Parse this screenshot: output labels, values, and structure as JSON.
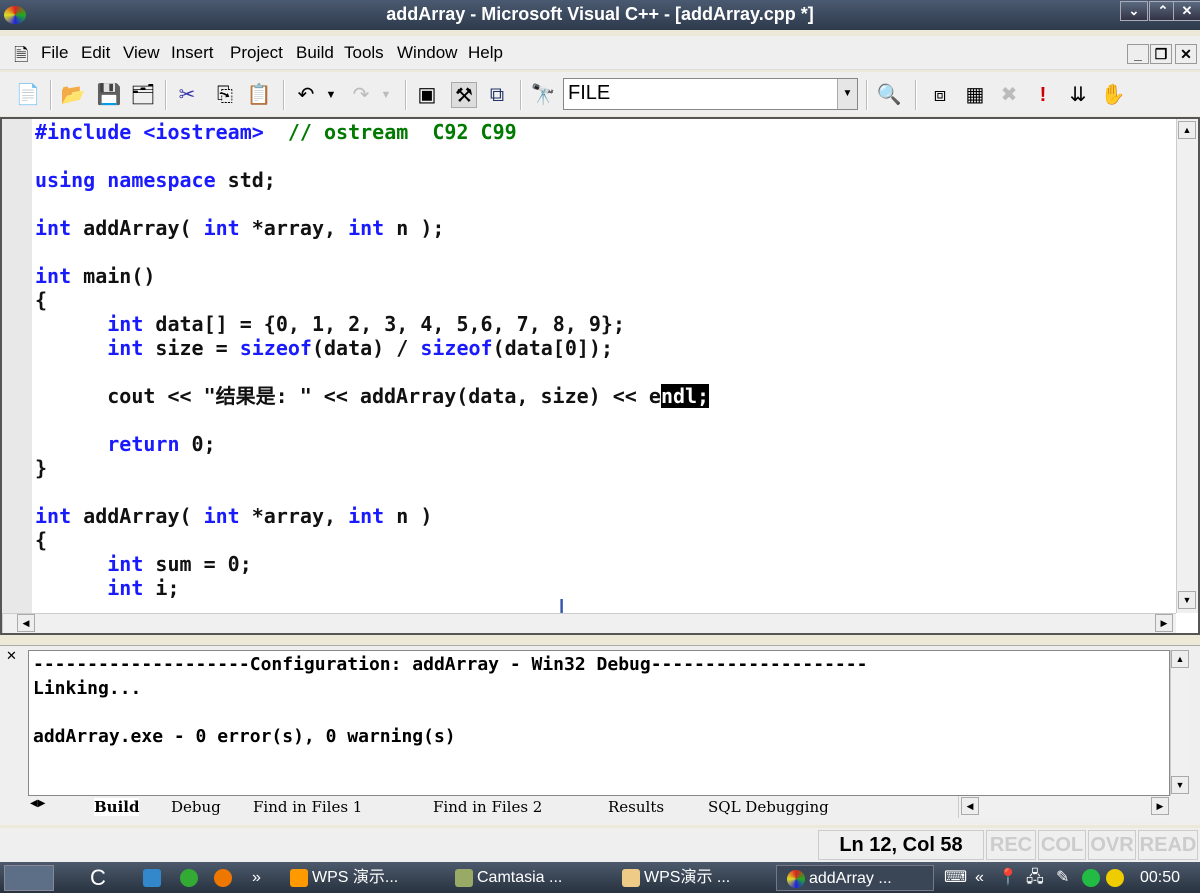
{
  "window": {
    "title": "addArray - Microsoft Visual C++ - [addArray.cpp *]",
    "buttons": [
      "⌄",
      "⌃",
      "✕"
    ]
  },
  "menu": [
    "File",
    "Edit",
    "View",
    "Insert",
    "Project",
    "Build",
    "Tools",
    "Window",
    "Help"
  ],
  "toolbar": {
    "combo_value": "FILE"
  },
  "code": [
    [
      [
        "#include <iostream>  ",
        "k0"
      ],
      [
        "// ostream  C92 C99",
        "c"
      ]
    ],
    [],
    [
      [
        "using",
        "k"
      ],
      [
        " ",
        ""
      ],
      [
        "namespace",
        "k"
      ],
      [
        " std;",
        ""
      ]
    ],
    [],
    [
      [
        "int",
        "k"
      ],
      [
        " addArray( ",
        ""
      ],
      [
        "int",
        "k"
      ],
      [
        " *array, ",
        ""
      ],
      [
        "int",
        "k"
      ],
      [
        " n );",
        ""
      ]
    ],
    [],
    [
      [
        "int",
        "k"
      ],
      [
        " main()",
        ""
      ]
    ],
    [
      [
        "{",
        ""
      ]
    ],
    [
      [
        "      ",
        ""
      ],
      [
        "int",
        "k"
      ],
      [
        " data[] = {0, 1, 2, 3, 4, 5,6, 7, 8, 9};",
        ""
      ]
    ],
    [
      [
        "      ",
        ""
      ],
      [
        "int",
        "k"
      ],
      [
        " size = ",
        ""
      ],
      [
        "sizeof",
        "k"
      ],
      [
        "(data) / ",
        ""
      ],
      [
        "sizeof",
        "k"
      ],
      [
        "(data[0]);",
        ""
      ]
    ],
    [],
    [
      [
        "      cout << \"结果是: \" << addArray(data, size) << e",
        ""
      ],
      [
        "ndl;",
        "s"
      ]
    ],
    [],
    [
      [
        "      ",
        ""
      ],
      [
        "return",
        "k"
      ],
      [
        " 0;",
        ""
      ]
    ],
    [
      [
        "}",
        ""
      ]
    ],
    [],
    [
      [
        "int",
        "k"
      ],
      [
        " addArray( ",
        ""
      ],
      [
        "int",
        "k"
      ],
      [
        " *array, ",
        ""
      ],
      [
        "int",
        "k"
      ],
      [
        " n )",
        ""
      ]
    ],
    [
      [
        "{",
        ""
      ]
    ],
    [
      [
        "      ",
        ""
      ],
      [
        "int",
        "k"
      ],
      [
        " sum = 0;",
        ""
      ]
    ],
    [
      [
        "      ",
        ""
      ],
      [
        "int",
        "k"
      ],
      [
        " i;",
        ""
      ]
    ]
  ],
  "output": {
    "lines": [
      "--------------------Configuration: addArray - Win32 Debug--------------------",
      "Linking...",
      "",
      "addArray.exe - 0 error(s), 0 warning(s)"
    ],
    "tabs": [
      "Build",
      "Debug",
      "Find in Files 1",
      "Find in Files 2",
      "Results",
      "SQL Debugging"
    ],
    "active_tab": "Build"
  },
  "status": {
    "position": "Ln 12, Col 58",
    "indicators": [
      "REC",
      "COL",
      "OVR",
      "READ"
    ]
  },
  "taskbar": {
    "items": [
      "WPS 演示...",
      "Camtasia ...",
      "WPS演示 ...",
      "addArray ..."
    ],
    "clock": "00:50",
    "overflow": "»",
    "tray_overflow": "«"
  }
}
